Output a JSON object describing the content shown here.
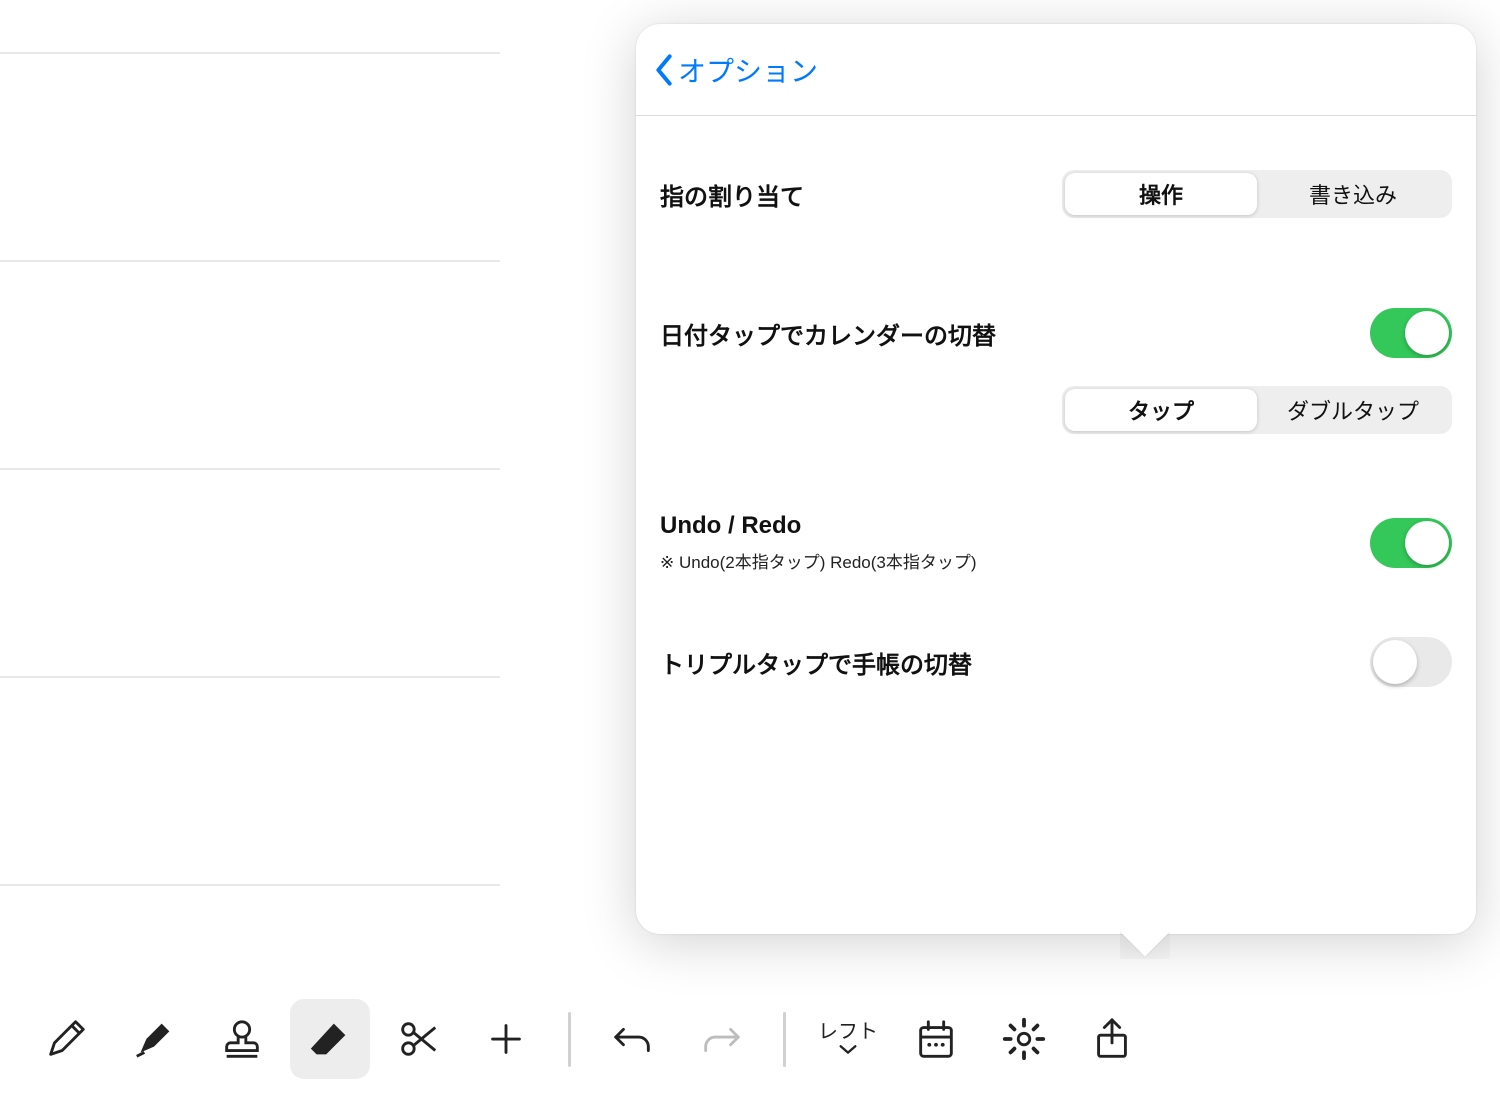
{
  "panel": {
    "back_label": "オプション",
    "finger_assign": {
      "label": "指の割り当て",
      "options": [
        "操作",
        "書き込み"
      ],
      "selected": 0
    },
    "date_tap": {
      "label": "日付タップでカレンダーの切替",
      "on": true,
      "options": [
        "タップ",
        "ダブルタップ"
      ],
      "selected": 0
    },
    "undo_redo": {
      "label": "Undo / Redo",
      "note": "※ Undo(2本指タップ) Redo(3本指タップ)",
      "on": true
    },
    "triple_tap": {
      "label": "トリプルタップで手帳の切替",
      "on": false
    }
  },
  "toolbar": {
    "left_label": "レフト"
  }
}
